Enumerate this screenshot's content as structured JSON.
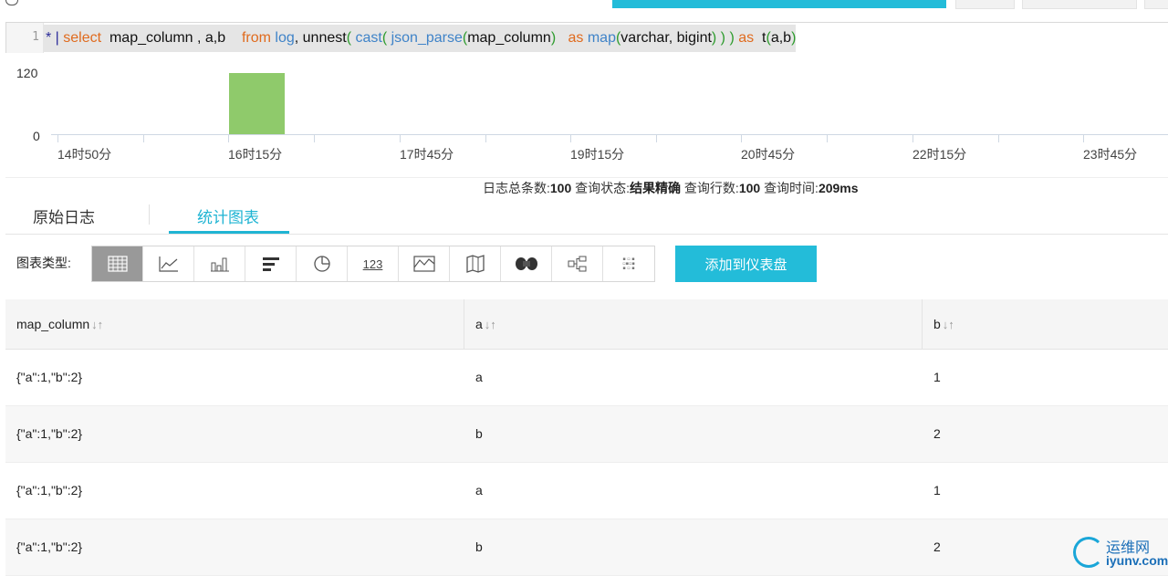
{
  "query": {
    "line_number": "1",
    "tokens": [
      {
        "t": "* ",
        "k": "op"
      },
      {
        "t": "| ",
        "k": "op"
      },
      {
        "t": "select",
        "k": "kw"
      },
      {
        "t": "  map_column , a,b    ",
        "k": "id"
      },
      {
        "t": "from",
        "k": "kw"
      },
      {
        "t": " ",
        "k": "id"
      },
      {
        "t": "log",
        "k": "fn"
      },
      {
        "t": ", unnest",
        "k": "id"
      },
      {
        "t": "( ",
        "k": "pa"
      },
      {
        "t": "cast",
        "k": "fn"
      },
      {
        "t": "( ",
        "k": "pa"
      },
      {
        "t": "json_parse",
        "k": "fn"
      },
      {
        "t": "(",
        "k": "pa"
      },
      {
        "t": "map_column",
        "k": "id"
      },
      {
        "t": ")",
        "k": "pa"
      },
      {
        "t": "   ",
        "k": "id"
      },
      {
        "t": "as",
        "k": "kw"
      },
      {
        "t": " ",
        "k": "id"
      },
      {
        "t": "map",
        "k": "fn"
      },
      {
        "t": "(",
        "k": "pa"
      },
      {
        "t": "varchar, bigint",
        "k": "id"
      },
      {
        "t": ") ) ) ",
        "k": "pa"
      },
      {
        "t": "as",
        "k": "kw"
      },
      {
        "t": "  t",
        "k": "id"
      },
      {
        "t": "(",
        "k": "pa"
      },
      {
        "t": "a,b",
        "k": "id"
      },
      {
        "t": ")",
        "k": "pa"
      }
    ]
  },
  "histogram": {
    "y_ticks": [
      "120",
      "0"
    ],
    "x_labels": [
      "14时50分",
      "16时15分",
      "17时45分",
      "19时15分",
      "20时45分",
      "22时15分",
      "23时45分"
    ],
    "bar_count": 100,
    "y_max": 120,
    "bar_color": "#8fca6b"
  },
  "stats": {
    "total_label": "日志总条数:",
    "total_value": "100",
    "status_label": "查询状态:",
    "status_value": "结果精确",
    "rows_label": "查询行数:",
    "rows_value": "100",
    "time_label": "查询时间:",
    "time_value": "209ms"
  },
  "tabs": {
    "raw_logs": "原始日志",
    "stats_chart": "统计图表"
  },
  "toolbar": {
    "chart_type_label": "图表类型:",
    "types": [
      "table-icon",
      "line-chart-icon",
      "bar-chart-icon",
      "horizontal-bar-icon",
      "pie-chart-icon",
      "number-icon",
      "area-chart-icon",
      "map-icon",
      "world-map-icon",
      "flow-chart-icon",
      "word-cloud-icon"
    ],
    "number_icon_text": "123",
    "add_to_dashboard": "添加到仪表盘"
  },
  "table": {
    "columns": [
      "map_column",
      "a",
      "b"
    ],
    "sort_glyph": "↓↑",
    "rows": [
      [
        "{\"a\":1,\"b\":2}",
        "a",
        "1"
      ],
      [
        "{\"a\":1,\"b\":2}",
        "b",
        "2"
      ],
      [
        "{\"a\":1,\"b\":2}",
        "a",
        "1"
      ],
      [
        "{\"a\":1,\"b\":2}",
        "b",
        "2"
      ]
    ]
  },
  "watermark": {
    "cn": "运维网",
    "en": "iyunv.com"
  },
  "colors": {
    "accent": "#23bcd9",
    "tab_active": "#1fb4d3"
  }
}
